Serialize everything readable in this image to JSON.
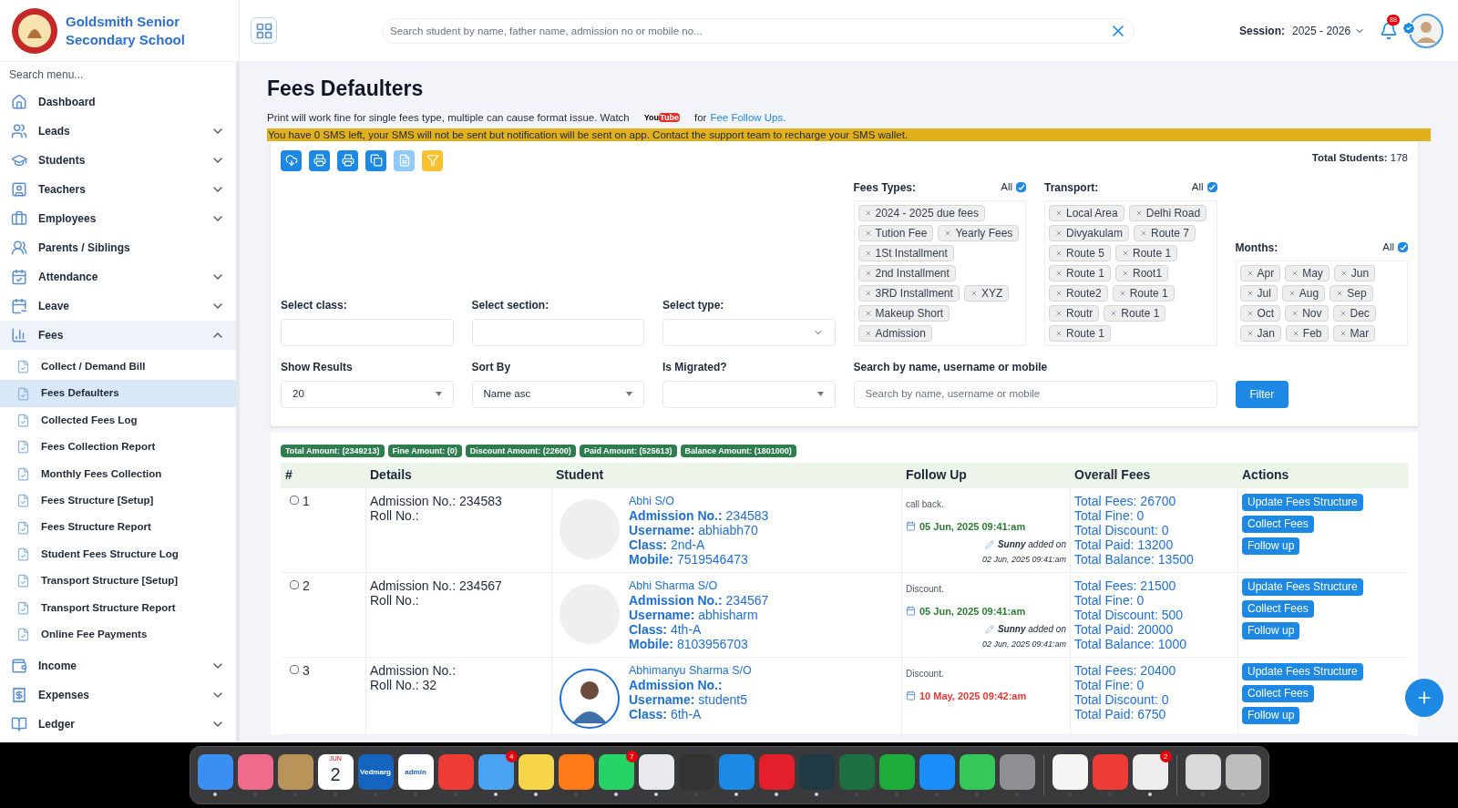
{
  "header": {
    "school": "Goldsmith Senior Secondary School",
    "search": {
      "placeholder": "Search student by name, father name, admission no or mobile no..."
    },
    "session_label": "Session:",
    "session_value": "2025 - 2026",
    "notifications": "88"
  },
  "sidebar": {
    "search": {
      "placeholder": "Search menu..."
    },
    "items": [
      {
        "label": "Dashboard",
        "selected": false
      },
      {
        "label": "Leads",
        "expanded": false,
        "selected": false
      },
      {
        "label": "Students",
        "expanded": false,
        "selected": false
      },
      {
        "label": "Teachers",
        "expanded": false,
        "selected": false
      },
      {
        "label": "Employees",
        "expanded": false,
        "selected": false
      },
      {
        "label": "Parents / Siblings",
        "selected": false
      },
      {
        "label": "Attendance",
        "expanded": false,
        "selected": false
      },
      {
        "label": "Leave",
        "expanded": false,
        "selected": false
      },
      {
        "label": "Fees",
        "expanded": true,
        "selected": true,
        "children": [
          {
            "label": "Collect / Demand Bill",
            "selected": false
          },
          {
            "label": "Fees Defaulters",
            "selected": true
          },
          {
            "label": "Collected Fees Log",
            "selected": false
          },
          {
            "label": "Fees Collection Report",
            "selected": false
          },
          {
            "label": "Monthly Fees Collection",
            "selected": false
          },
          {
            "label": "Fees Structure [Setup]",
            "selected": false
          },
          {
            "label": "Fees Structure Report",
            "selected": false
          },
          {
            "label": "Student Fees Structure Log",
            "selected": false
          },
          {
            "label": "Transport Structure [Setup]",
            "selected": false
          },
          {
            "label": "Transport Structure Report",
            "selected": false
          },
          {
            "label": "Online Fee Payments",
            "selected": false
          }
        ]
      },
      {
        "label": "Income",
        "expanded": false,
        "selected": false
      },
      {
        "label": "Expenses",
        "expanded": false,
        "selected": false
      },
      {
        "label": "Ledger",
        "expanded": false,
        "selected": false
      }
    ]
  },
  "page": {
    "title": "Fees Defaulters",
    "notice": {
      "text": "Print will work fine for single fees type, multiple can cause format issue. Watch",
      "logo": "YouTube",
      "middle": "for",
      "link": "Fee Follow Ups."
    },
    "warning": "You have 0 SMS left, your SMS will not be sent but notification will be sent on app. Contact the support team to recharge your SMS wallet.",
    "toolbar": [
      {
        "color": "#1e88e5"
      },
      {
        "color": "#1e88e5"
      },
      {
        "color": "#1e88e5"
      },
      {
        "color": "#1e88e5"
      },
      {
        "color": "#90caf9"
      },
      {
        "color": "#fbc02d"
      }
    ],
    "total_students": "**Total Students:** 178",
    "filters": {
      "class": {
        "label": "Select class:"
      },
      "section": {
        "label": "Select section:"
      },
      "type": {
        "label": "Select type:"
      },
      "fees_types": {
        "label": "Fees Types:",
        "all_label": "All",
        "all_checked": true,
        "chips": [
          "2024 - 2025 due fees",
          "Tution Fee",
          "Yearly Fees",
          "1St Installment",
          "2nd Installment",
          "3RD Installment",
          "XYZ",
          "Makeup Short",
          "Admission"
        ]
      },
      "transport": {
        "label": "Transport:",
        "all_label": "All",
        "all_checked": true,
        "chips": [
          "Local Area",
          "Delhi Road",
          "Divyakulam",
          "Route 7",
          "Route 5",
          "Route 1",
          "Route 1",
          "Root1",
          "Route2",
          "Route 1",
          "Routr",
          "Route 1",
          "Route 1"
        ]
      },
      "months": {
        "label": "Months:",
        "all_label": "All",
        "all_checked": true,
        "chips": [
          "Apr",
          "May",
          "Jun",
          "Jul",
          "Aug",
          "Sep",
          "Oct",
          "Nov",
          "Dec",
          "Jan",
          "Feb",
          "Mar"
        ]
      },
      "show_results": {
        "label": "Show Results",
        "value": "20"
      },
      "sort_by": {
        "label": "Sort By",
        "value": "Name asc"
      },
      "migrated": {
        "label": "Is Migrated?"
      },
      "search": {
        "label": "Search by name, username or mobile",
        "placeholder": "Search by name, username or mobile"
      },
      "filter_button": "Filter"
    },
    "summary": [
      "Total Amount: (2349213)",
      "Fine Amount: (0)",
      "Discount Amount: (22600)",
      "Paid Amount: (525613)",
      "Balance Amount: (1801000)"
    ],
    "table": {
      "columns": [
        "#",
        "Details",
        "Student",
        "Follow Up",
        "Overall Fees",
        "Actions"
      ],
      "rows": [
        {
          "checked": false,
          "index": "1",
          "details": [
            "Admission No.: 234583",
            "Roll No.:"
          ],
          "avatar": {
            "kind": "blank"
          },
          "name": "Abhi S/O",
          "info": [
            "**Admission No.:** 234583",
            "**Username:** abhiabh70",
            "**Class:** 2nd-A",
            "**Mobile:** 7519546473"
          ],
          "follow_up": {
            "note": "call back.",
            "date": "05 Jun, 2025 09:41:am",
            "color": "#2e7d32",
            "added": "**Sunny** added on",
            "added_on": "02 Jun, 2025 09:41:am"
          },
          "fees": [
            "Total Fees: 26700",
            "Total Fine: 0",
            "Total Discount: 0",
            "Total Paid: 13200",
            "Total Balance: 13500"
          ],
          "actions": [
            "Update Fees Structure",
            "Collect Fees",
            "Follow up"
          ]
        },
        {
          "checked": false,
          "index": "2",
          "details": [
            "Admission No.: 234567",
            "Roll No.:"
          ],
          "avatar": {
            "kind": "blank"
          },
          "name": "Abhi Sharma S/O",
          "info": [
            "**Admission No.:** 234567",
            "**Username:** abhisharm",
            "**Class:** 4th-A",
            "**Mobile:** 8103956703"
          ],
          "follow_up": {
            "note": "Discount.",
            "date": "05 Jun, 2025 09:41:am",
            "color": "#2e7d32",
            "added": "**Sunny** added on",
            "added_on": "02 Jun, 2025 09:41:am"
          },
          "fees": [
            "Total Fees: 21500",
            "Total Fine: 0",
            "Total Discount: 500",
            "Total Paid: 20000",
            "Total Balance: 1000"
          ],
          "actions": [
            "Update Fees Structure",
            "Collect Fees",
            "Follow up"
          ]
        },
        {
          "checked": false,
          "index": "3",
          "details": [
            "Admission No.:",
            "Roll No.: 32"
          ],
          "avatar": {
            "kind": "person"
          },
          "name": "Abhimanyu Sharma S/O",
          "info": [
            "**Admission No.:**",
            "**Username:** student5",
            "**Class:** 6th-A"
          ],
          "follow_up": {
            "note": "Discount.",
            "date": "10 May, 2025 09:42:am",
            "color": "#e53935"
          },
          "fees": [
            "Total Fees: 20400",
            "Total Fine: 0",
            "Total Discount: 0",
            "Total Paid: 6750"
          ],
          "actions": [
            "Update Fees Structure",
            "Collect Fees",
            "Follow up"
          ]
        }
      ]
    }
  },
  "dock": [
    {
      "kind": "app",
      "color": "#3b8ff3",
      "running": true
    },
    {
      "kind": "app",
      "color": "#f06a8c",
      "running": false
    },
    {
      "kind": "app",
      "color": "#b8935a",
      "running": false
    },
    {
      "kind": "calendar",
      "color": "#ffffff",
      "month": "JUN",
      "day": "2",
      "running": false
    },
    {
      "kind": "text",
      "color": "#1565c0",
      "label": "Vedmarg",
      "running": false
    },
    {
      "kind": "text",
      "color": "#ffffff",
      "label": "admin",
      "running": false
    },
    {
      "kind": "app",
      "color": "#ef3b36",
      "running": false
    },
    {
      "kind": "app",
      "color": "#4aa3f0",
      "badge": "4",
      "running": true
    },
    {
      "kind": "app",
      "color": "#f7d54a",
      "running": true
    },
    {
      "kind": "app",
      "color": "#ff7a18",
      "running": false
    },
    {
      "kind": "app",
      "color": "#25d366",
      "badge": "7",
      "running": true
    },
    {
      "kind": "app",
      "color": "#e8eaed",
      "running": true
    },
    {
      "kind": "app",
      "color": "#333333",
      "running": false
    },
    {
      "kind": "app",
      "color": "#1e88e5",
      "running": true
    },
    {
      "kind": "app",
      "color": "#e41e2b",
      "running": true
    },
    {
      "kind": "app",
      "color": "#1f3a44",
      "running": true
    },
    {
      "kind": "app",
      "color": "#1d6f42",
      "running": false
    },
    {
      "kind": "app",
      "color": "#1faa3c",
      "running": false
    },
    {
      "kind": "app",
      "color": "#1c8ef9",
      "running": false
    },
    {
      "kind": "app",
      "color": "#34c759",
      "running": false
    },
    {
      "kind": "app",
      "color": "#8e8e93",
      "running": false
    },
    {
      "kind": "separator"
    },
    {
      "kind": "app",
      "color": "#f5f5f5",
      "running": false
    },
    {
      "kind": "app",
      "color": "#ef3b36",
      "running": false
    },
    {
      "kind": "app",
      "color": "#eeeeee",
      "badge": "2",
      "running": true
    },
    {
      "kind": "separator"
    },
    {
      "kind": "app",
      "color": "#d9d9d9",
      "running": false
    },
    {
      "kind": "app",
      "color": "#bdbdbd",
      "running": false
    }
  ]
}
